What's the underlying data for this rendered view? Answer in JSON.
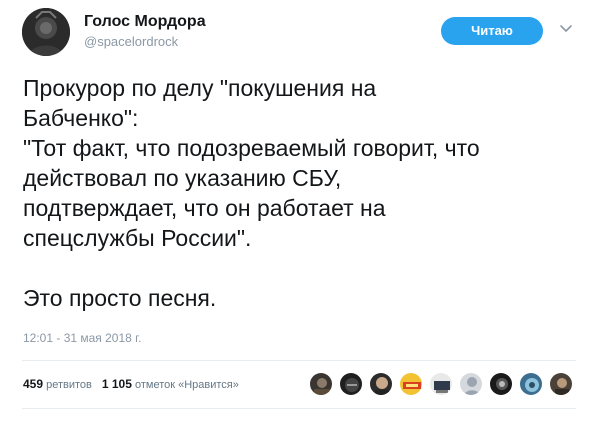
{
  "author": {
    "display_name": "Голос Мордора",
    "handle": "@spacelordrock"
  },
  "follow_button_label": "Читаю",
  "tweet_lines": [
    "Прокурор по делу \"покушения на",
    "Бабченко\":",
    "\"Тот факт, что подозреваемый говорит, что",
    "действовал по указанию СБУ,",
    "подтверждает, что он работает на",
    "спецслужбы России\".",
    "",
    "Это просто песня."
  ],
  "timestamp": "12:01 - 31 мая 2018 г.",
  "stats": {
    "retweets_count": "459",
    "retweets_label": "ретвитов",
    "likes_count": "1 105",
    "likes_label": "отметок «Нравится»"
  },
  "icons": {
    "caret": "chevron-down-icon",
    "avatar": "user-avatar"
  },
  "colors": {
    "follow_button": "#2aa3ef",
    "text": "#14171a",
    "secondary_text": "#8b98a5"
  }
}
